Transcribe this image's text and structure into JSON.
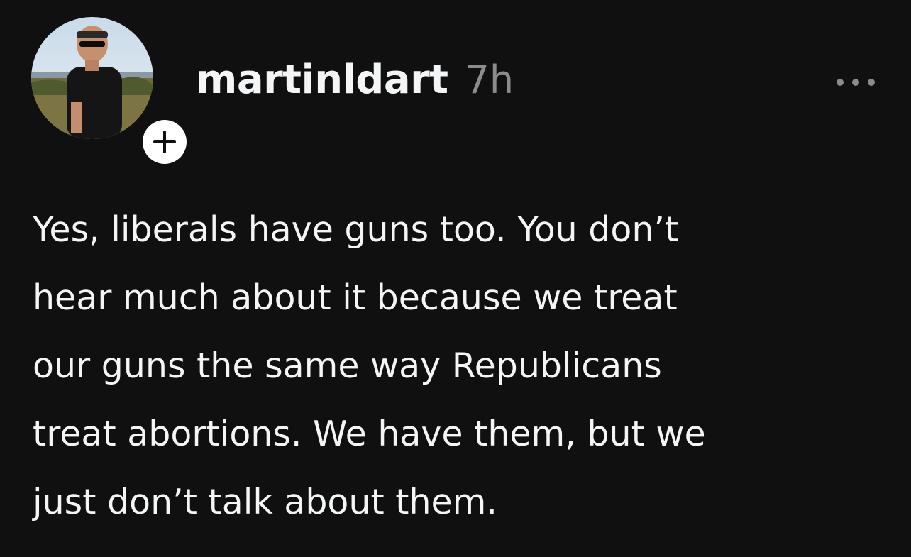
{
  "post": {
    "username": "martinldart",
    "timestamp": "7h",
    "avatar_icon": "profile-photo",
    "follow_icon": "plus-icon",
    "more_icon": "ellipsis-icon",
    "text_lines": [
      "Yes, liberals have guns too. You don’t",
      "hear much about it because we treat",
      "our guns the same way Republicans",
      "treat abortions. We have them, but we",
      "just don’t talk about them."
    ]
  },
  "colors": {
    "background": "#101010",
    "primary_text": "#f3f5f7",
    "secondary_text": "#8c8c8c"
  }
}
